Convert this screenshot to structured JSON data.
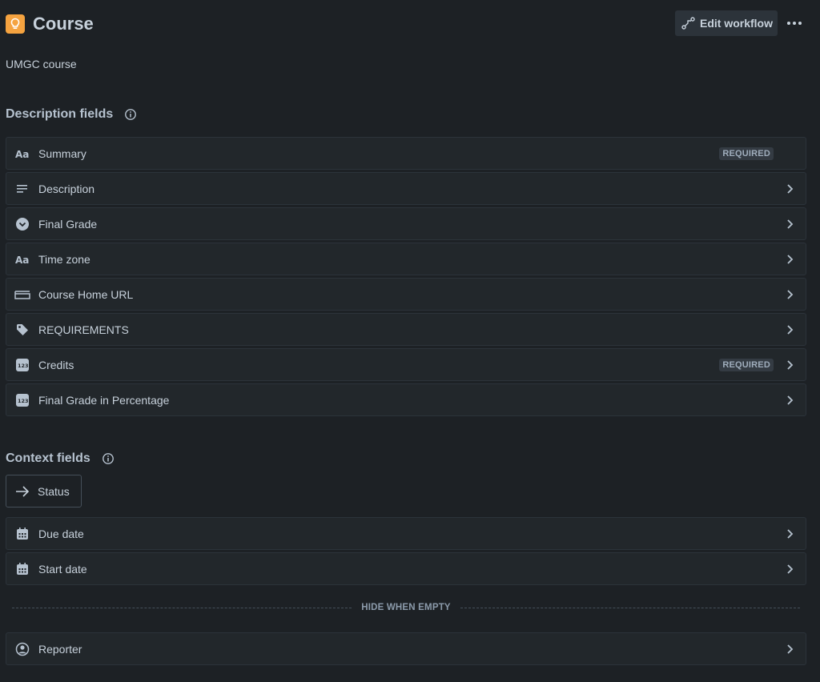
{
  "header": {
    "title": "Course",
    "type_icon": "lightbulb-icon",
    "accent_color": "#f5a340",
    "edit_workflow_label": "Edit workflow",
    "more_icon": "more-horizontal-icon"
  },
  "subtitle": "UMGC course",
  "description_section": {
    "title": "Description fields",
    "info_icon": "info-icon",
    "fields": [
      {
        "label": "Summary",
        "icon": "text-icon",
        "badge": "REQUIRED"
      },
      {
        "label": "Description",
        "icon": "paragraph-icon"
      },
      {
        "label": "Final Grade",
        "icon": "select-dropdown-icon"
      },
      {
        "label": "Time zone",
        "icon": "text-icon"
      },
      {
        "label": "Course Home URL",
        "icon": "url-field-icon"
      },
      {
        "label": "REQUIREMENTS",
        "icon": "tag-icon"
      },
      {
        "label": "Credits",
        "icon": "number-icon",
        "badge": "REQUIRED"
      },
      {
        "label": "Final Grade in Percentage",
        "icon": "number-icon"
      }
    ]
  },
  "context_section": {
    "title": "Context fields",
    "info_icon": "info-icon",
    "status_label": "Status",
    "fields": [
      {
        "label": "Due date",
        "icon": "calendar-icon"
      },
      {
        "label": "Start date",
        "icon": "calendar-icon"
      }
    ],
    "hide_when_empty_label": "HIDE WHEN EMPTY",
    "hidden_fields": [
      {
        "label": "Reporter",
        "icon": "user-avatar-icon"
      }
    ]
  }
}
